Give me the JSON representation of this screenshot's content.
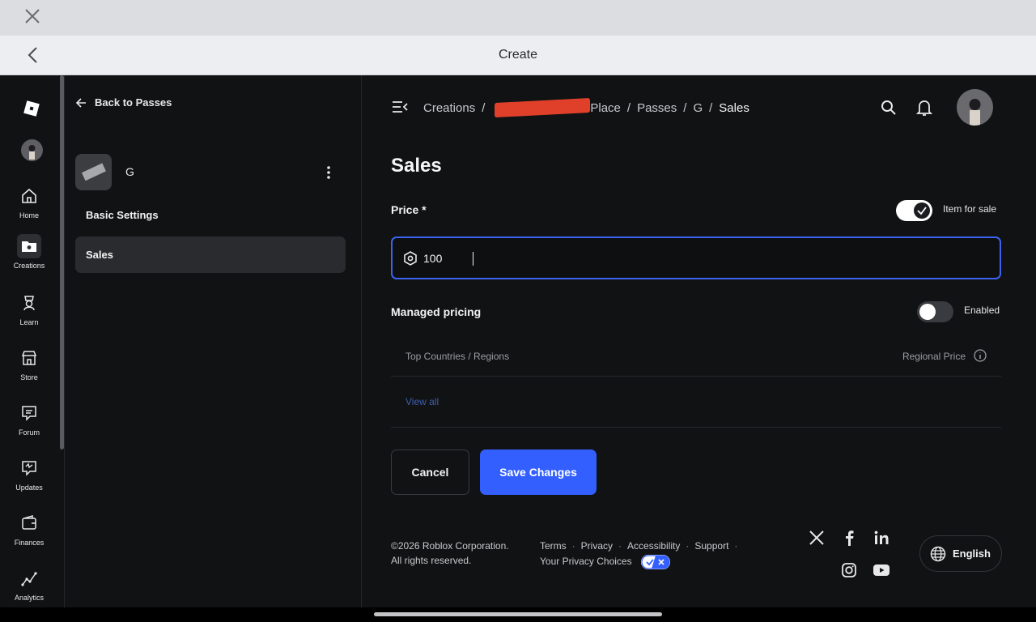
{
  "topbar": {
    "title": "Create"
  },
  "nav": {
    "items": [
      {
        "label": "Home",
        "icon": "home-icon"
      },
      {
        "label": "Creations",
        "icon": "folder-icon",
        "active": true
      },
      {
        "label": "Learn",
        "icon": "learn-icon"
      },
      {
        "label": "Store",
        "icon": "store-icon"
      },
      {
        "label": "Forum",
        "icon": "forum-icon"
      },
      {
        "label": "Updates",
        "icon": "updates-icon"
      },
      {
        "label": "Finances",
        "icon": "wallet-icon"
      },
      {
        "label": "Analytics",
        "icon": "analytics-icon"
      }
    ]
  },
  "panel": {
    "back_label": "Back to Passes",
    "pass_name": "G",
    "menu": [
      {
        "label": "Basic Settings",
        "active": false
      },
      {
        "label": "Sales",
        "active": true
      }
    ]
  },
  "breadcrumb": {
    "items": [
      "Creations",
      "Place",
      "Passes",
      "G",
      "Sales"
    ]
  },
  "main": {
    "title": "Sales",
    "price_label": "Price *",
    "item_for_sale_label": "Item for sale",
    "item_for_sale_on": true,
    "price_value": "100",
    "managed_pricing_label": "Managed pricing",
    "enabled_label": "Enabled",
    "enabled_on": false,
    "table_col1": "Top Countries / Regions",
    "table_col2": "Regional Price",
    "view_all": "View all",
    "cancel_label": "Cancel",
    "save_label": "Save Changes"
  },
  "footer": {
    "copyright1": "©2026 Roblox Corporation.",
    "copyright2": "All rights reserved.",
    "links": [
      "Terms",
      "Privacy",
      "Accessibility",
      "Support"
    ],
    "privacy_choices": "Your Privacy Choices",
    "language": "English"
  },
  "colors": {
    "accent": "#335fff",
    "toggle_on": "#ffffff",
    "toggle_off": "#3a3b40",
    "redaction": "#e0402a"
  }
}
